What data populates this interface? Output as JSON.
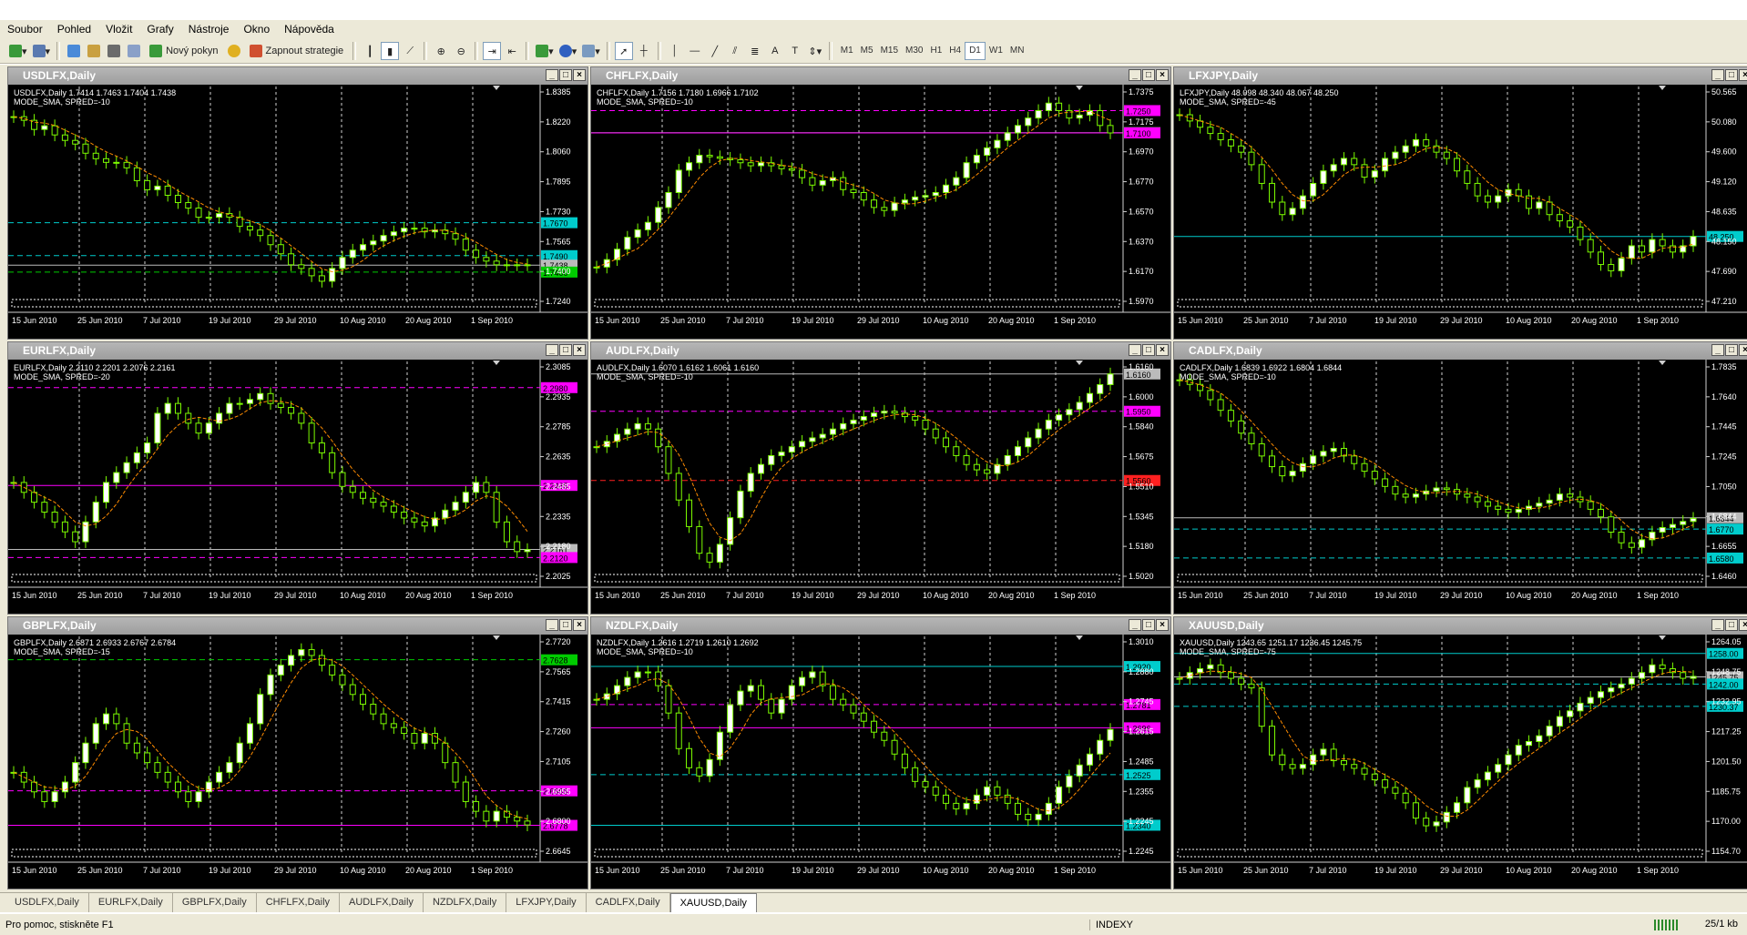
{
  "menu": [
    "Soubor",
    "Pohled",
    "Vložit",
    "Grafy",
    "Nástroje",
    "Okno",
    "Nápověda"
  ],
  "toolbar": {
    "new_order": "Nový pokyn",
    "strategies": "Zapnout strategie",
    "timeframes": [
      "M1",
      "M5",
      "M15",
      "M30",
      "H1",
      "H4",
      "D1",
      "W1",
      "MN"
    ],
    "active_timeframe": "D1"
  },
  "x_labels": [
    "15 Jun 2010",
    "25 Jun 2010",
    "7 Jul 2010",
    "19 Jul 2010",
    "29 Jul 2010",
    "10 Aug 2010",
    "20 Aug 2010",
    "1 Sep 2010"
  ],
  "charts": [
    {
      "title": "USDLFX,Daily",
      "info": "USDLFX,Daily  1.7414 1.7463 1.7404 1.7438",
      "mode": "MODE_SMA, SPRED=-10",
      "yticks": [
        "1.8385",
        "1.8220",
        "1.8060",
        "1.7895",
        "1.7730",
        "1.7565",
        "1.7400",
        "1.7240"
      ],
      "ymin": 1.724,
      "ymax": 1.8385,
      "path": [
        1.825,
        1.823,
        1.818,
        1.82,
        1.815,
        1.812,
        1.81,
        1.805,
        1.802,
        1.8,
        1.8,
        1.797,
        1.79,
        1.785,
        1.787,
        1.782,
        1.778,
        1.775,
        1.77,
        1.77,
        1.772,
        1.77,
        1.765,
        1.763,
        1.76,
        1.755,
        1.75,
        1.744,
        1.742,
        1.738,
        1.735,
        1.742,
        1.748,
        1.752,
        1.755,
        1.757,
        1.76,
        1.762,
        1.764,
        1.764,
        1.762,
        1.763,
        1.761,
        1.758,
        1.752,
        1.748,
        1.746,
        1.744,
        1.744,
        1.744,
        1.744
      ],
      "lines": [
        {
          "v": 1.767,
          "c": "#00cccc",
          "d": true,
          "label": "1.7670"
        },
        {
          "v": 1.749,
          "c": "#00cccc",
          "d": true,
          "label": "1.7490"
        },
        {
          "v": 1.7438,
          "c": "#bbbbbb",
          "d": false,
          "label": "1.7438"
        },
        {
          "v": 1.74,
          "c": "#00cc00",
          "d": true,
          "label": "1.7400"
        }
      ]
    },
    {
      "title": "CHFLFX,Daily",
      "info": "CHFLFX,Daily  1.7156 1.7180 1.6966 1.7102",
      "mode": "MODE_SMA, SPRED=-10",
      "yticks": [
        "1.7375",
        "1.7175",
        "1.6970",
        "1.6770",
        "1.6570",
        "1.6370",
        "1.6170",
        "1.5970"
      ],
      "ymin": 1.597,
      "ymax": 1.7375,
      "path": [
        1.62,
        1.625,
        1.632,
        1.64,
        1.645,
        1.65,
        1.66,
        1.67,
        1.685,
        1.69,
        1.695,
        1.694,
        1.693,
        1.692,
        1.69,
        1.688,
        1.69,
        1.688,
        1.686,
        1.685,
        1.68,
        1.675,
        1.678,
        1.68,
        1.672,
        1.67,
        1.665,
        1.66,
        1.658,
        1.663,
        1.665,
        1.667,
        1.668,
        1.67,
        1.675,
        1.68,
        1.69,
        1.695,
        1.7,
        1.705,
        1.71,
        1.715,
        1.72,
        1.725,
        1.73,
        1.725,
        1.72,
        1.722,
        1.725,
        1.715,
        1.71
      ],
      "lines": [
        {
          "v": 1.725,
          "c": "#ff00ff",
          "d": true,
          "label": "1.7250"
        },
        {
          "v": 1.7102,
          "c": "#bbbbbb",
          "d": false,
          "label": "1.7102"
        },
        {
          "v": 1.71,
          "c": "#ff00ff",
          "d": false,
          "label": "1.7100"
        }
      ]
    },
    {
      "title": "LFXJPY,Daily",
      "info": "LFXJPY,Daily  48.098 48.340 48.067 48.250",
      "mode": "MODE_SMA, SPRED=-45",
      "yticks": [
        "50.565",
        "50.080",
        "49.600",
        "49.120",
        "48.635",
        "48.150",
        "47.690",
        "47.210"
      ],
      "ymin": 47.21,
      "ymax": 50.565,
      "path": [
        50.2,
        50.1,
        50.0,
        49.9,
        49.8,
        49.7,
        49.6,
        49.4,
        49.1,
        48.8,
        48.6,
        48.7,
        48.9,
        49.1,
        49.3,
        49.4,
        49.5,
        49.4,
        49.2,
        49.3,
        49.5,
        49.6,
        49.7,
        49.8,
        49.7,
        49.6,
        49.5,
        49.3,
        49.1,
        48.9,
        48.8,
        48.9,
        49.0,
        48.9,
        48.7,
        48.8,
        48.6,
        48.5,
        48.4,
        48.2,
        48.0,
        47.8,
        47.7,
        47.9,
        48.1,
        48.0,
        48.2,
        48.1,
        48.0,
        48.1,
        48.25
      ],
      "lines": [
        {
          "v": 48.25,
          "c": "#00cccc",
          "d": false,
          "label": "48.250"
        }
      ]
    },
    {
      "title": "EURLFX,Daily",
      "info": "EURLFX,Daily  2.2110 2.2201 2.2076 2.2161",
      "mode": "MODE_SMA, SPRED=-20",
      "yticks": [
        "2.3085",
        "2.2935",
        "2.2785",
        "2.2635",
        "2.2485",
        "2.2335",
        "2.2180",
        "2.2025"
      ],
      "ymin": 2.2025,
      "ymax": 2.3085,
      "path": [
        2.25,
        2.245,
        2.24,
        2.235,
        2.23,
        2.225,
        2.22,
        2.23,
        2.24,
        2.25,
        2.255,
        2.26,
        2.265,
        2.27,
        2.285,
        2.29,
        2.285,
        2.28,
        2.275,
        2.28,
        2.285,
        2.29,
        2.29,
        2.292,
        2.295,
        2.29,
        2.288,
        2.285,
        2.28,
        2.27,
        2.265,
        2.255,
        2.248,
        2.245,
        2.242,
        2.24,
        2.238,
        2.235,
        2.232,
        2.23,
        2.228,
        2.232,
        2.236,
        2.24,
        2.245,
        2.25,
        2.245,
        2.23,
        2.22,
        2.215,
        2.216
      ],
      "lines": [
        {
          "v": 2.298,
          "c": "#ff00ff",
          "d": true,
          "label": "2.2980"
        },
        {
          "v": 2.2485,
          "c": "#ff00ff",
          "d": false,
          "label": "2.2485"
        },
        {
          "v": 2.2161,
          "c": "#bbbbbb",
          "d": false,
          "label": "2.2161"
        },
        {
          "v": 2.212,
          "c": "#ff00ff",
          "d": true,
          "label": "2.2120"
        }
      ]
    },
    {
      "title": "AUDLFX,Daily",
      "info": "AUDLFX,Daily  1.6070 1.6162 1.6061 1.6160",
      "mode": "MODE_SMA, SPRED=-10",
      "yticks": [
        "1.6160",
        "1.6000",
        "1.5840",
        "1.5675",
        "1.5510",
        "1.5345",
        "1.5180",
        "1.5020"
      ],
      "ymin": 1.502,
      "ymax": 1.62,
      "path": [
        1.575,
        1.578,
        1.582,
        1.585,
        1.588,
        1.585,
        1.575,
        1.56,
        1.545,
        1.53,
        1.515,
        1.51,
        1.52,
        1.535,
        1.55,
        1.56,
        1.565,
        1.57,
        1.572,
        1.575,
        1.578,
        1.58,
        1.582,
        1.585,
        1.588,
        1.59,
        1.592,
        1.594,
        1.595,
        1.594,
        1.592,
        1.59,
        1.585,
        1.58,
        1.575,
        1.57,
        1.565,
        1.562,
        1.56,
        1.565,
        1.57,
        1.575,
        1.58,
        1.585,
        1.59,
        1.593,
        1.596,
        1.6,
        1.605,
        1.61,
        1.616
      ],
      "lines": [
        {
          "v": 1.616,
          "c": "#bbbbbb",
          "d": false,
          "label": "1.6160"
        },
        {
          "v": 1.595,
          "c": "#ff00ff",
          "d": true,
          "label": "1.5950"
        },
        {
          "v": 1.556,
          "c": "#ff2020",
          "d": true,
          "label": "1.5560"
        }
      ]
    },
    {
      "title": "CADLFX,Daily",
      "info": "CADLFX,Daily  1.6839 1.6922 1.6804 1.6844",
      "mode": "MODE_SMA, SPRED=-10",
      "yticks": [
        "1.7835",
        "1.7640",
        "1.7445",
        "1.7245",
        "1.7050",
        "1.6844",
        "1.6655",
        "1.6460"
      ],
      "ymin": 1.646,
      "ymax": 1.7835,
      "path": [
        1.775,
        1.772,
        1.768,
        1.762,
        1.755,
        1.748,
        1.74,
        1.733,
        1.725,
        1.718,
        1.712,
        1.715,
        1.72,
        1.725,
        1.728,
        1.73,
        1.725,
        1.72,
        1.715,
        1.71,
        1.705,
        1.7,
        1.698,
        1.7,
        1.702,
        1.704,
        1.703,
        1.7,
        1.698,
        1.695,
        1.692,
        1.69,
        1.688,
        1.69,
        1.692,
        1.694,
        1.696,
        1.7,
        1.698,
        1.695,
        1.69,
        1.685,
        1.675,
        1.668,
        1.665,
        1.67,
        1.675,
        1.678,
        1.68,
        1.682,
        1.684
      ],
      "lines": [
        {
          "v": 1.6844,
          "c": "#bbbbbb",
          "d": false,
          "label": "1.6844"
        },
        {
          "v": 1.677,
          "c": "#00cccc",
          "d": true,
          "label": "1.6770"
        },
        {
          "v": 1.658,
          "c": "#00cccc",
          "d": true,
          "label": "1.6580"
        }
      ]
    },
    {
      "title": "GBPLFX,Daily",
      "info": "GBPLFX,Daily  2.6871 2.6933 2.6767 2.6784",
      "mode": "MODE_SMA, SPRED=-15",
      "yticks": [
        "2.7720",
        "2.7565",
        "2.7415",
        "2.7260",
        "2.7105",
        "2.6955",
        "2.6800",
        "2.6645"
      ],
      "ymin": 2.6645,
      "ymax": 2.772,
      "path": [
        2.705,
        2.7,
        2.695,
        2.69,
        2.695,
        2.7,
        2.71,
        2.72,
        2.73,
        2.735,
        2.73,
        2.72,
        2.715,
        2.71,
        2.705,
        2.7,
        2.695,
        2.69,
        2.695,
        2.7,
        2.705,
        2.71,
        2.72,
        2.73,
        2.745,
        2.755,
        2.76,
        2.765,
        2.768,
        2.765,
        2.76,
        2.755,
        2.75,
        2.745,
        2.74,
        2.735,
        2.73,
        2.728,
        2.725,
        2.72,
        2.725,
        2.72,
        2.71,
        2.7,
        2.69,
        2.685,
        2.68,
        2.685,
        2.682,
        2.68,
        2.678
      ],
      "lines": [
        {
          "v": 2.7628,
          "c": "#00cc00",
          "d": true,
          "label": "2.7628"
        },
        {
          "v": 2.6955,
          "c": "#ff00ff",
          "d": true,
          "label": "2.6955"
        },
        {
          "v": 2.6778,
          "c": "#ff00ff",
          "d": false,
          "label": "2.6778"
        }
      ]
    },
    {
      "title": "NZDLFX,Daily",
      "info": "NZDLFX,Daily  1.2616 1.2719 1.2610 1.2692",
      "mode": "MODE_SMA, SPRED=-10",
      "yticks": [
        "1.3010",
        "1.2880",
        "1.2745",
        "1.2615",
        "1.2485",
        "1.2355",
        "1.2245",
        "1.2245"
      ],
      "ymin": 1.2245,
      "ymax": 1.301,
      "path": [
        1.28,
        1.282,
        1.285,
        1.288,
        1.29,
        1.29,
        1.285,
        1.275,
        1.262,
        1.255,
        1.252,
        1.258,
        1.268,
        1.278,
        1.283,
        1.285,
        1.28,
        1.275,
        1.28,
        1.285,
        1.288,
        1.29,
        1.285,
        1.28,
        1.278,
        1.275,
        1.272,
        1.268,
        1.265,
        1.26,
        1.255,
        1.25,
        1.248,
        1.245,
        1.242,
        1.24,
        1.242,
        1.245,
        1.248,
        1.245,
        1.242,
        1.238,
        1.236,
        1.238,
        1.242,
        1.248,
        1.252,
        1.256,
        1.26,
        1.265,
        1.269
      ],
      "lines": [
        {
          "v": 1.292,
          "c": "#00cccc",
          "d": false,
          "label": "1.2920"
        },
        {
          "v": 1.2781,
          "c": "#ff00ff",
          "d": true,
          "label": "1.2781"
        },
        {
          "v": 1.2696,
          "c": "#ff00ff",
          "d": false,
          "label": "1.2696"
        },
        {
          "v": 1.2525,
          "c": "#00cccc",
          "d": true,
          "label": "1.2525"
        },
        {
          "v": 1.234,
          "c": "#00cccc",
          "d": false,
          "label": "1.2340"
        }
      ]
    },
    {
      "title": "XAUUSD,Daily",
      "info": "XAUUSD,Daily  1243.65 1251.17 1236.45 1245.75",
      "mode": "MODE_SMA, SPRED=-75",
      "yticks": [
        "1264.05",
        "1248.75",
        "1232.95",
        "1217.25",
        "1201.50",
        "1185.75",
        "1170.00",
        "1154.70"
      ],
      "ymin": 1154.7,
      "ymax": 1264.05,
      "path": [
        1245,
        1248,
        1250,
        1252,
        1248,
        1245,
        1242,
        1240,
        1220,
        1205,
        1200,
        1198,
        1200,
        1205,
        1208,
        1202,
        1200,
        1198,
        1195,
        1192,
        1188,
        1185,
        1180,
        1172,
        1168,
        1170,
        1175,
        1180,
        1188,
        1192,
        1196,
        1200,
        1205,
        1210,
        1212,
        1215,
        1220,
        1225,
        1228,
        1232,
        1235,
        1238,
        1240,
        1242,
        1245,
        1248,
        1252,
        1250,
        1248,
        1245,
        1246
      ],
      "lines": [
        {
          "v": 1258.0,
          "c": "#00cccc",
          "d": false,
          "label": "1258.00"
        },
        {
          "v": 1245.75,
          "c": "#bbbbbb",
          "d": false,
          "label": "1245.75"
        },
        {
          "v": 1242.0,
          "c": "#00cccc",
          "d": true,
          "label": "1242.00"
        },
        {
          "v": 1230.37,
          "c": "#00cccc",
          "d": true,
          "label": "1230.37"
        }
      ]
    }
  ],
  "tabs": [
    "USDLFX,Daily",
    "EURLFX,Daily",
    "GBPLFX,Daily",
    "CHFLFX,Daily",
    "AUDLFX,Daily",
    "NZDLFX,Daily",
    "LFXJPY,Daily",
    "CADLFX,Daily",
    "XAUUSD,Daily"
  ],
  "active_tab": "XAUUSD,Daily",
  "status": {
    "help": "Pro pomoc, stiskněte F1",
    "profile": "INDEXY",
    "connection": "25/1 kb"
  }
}
